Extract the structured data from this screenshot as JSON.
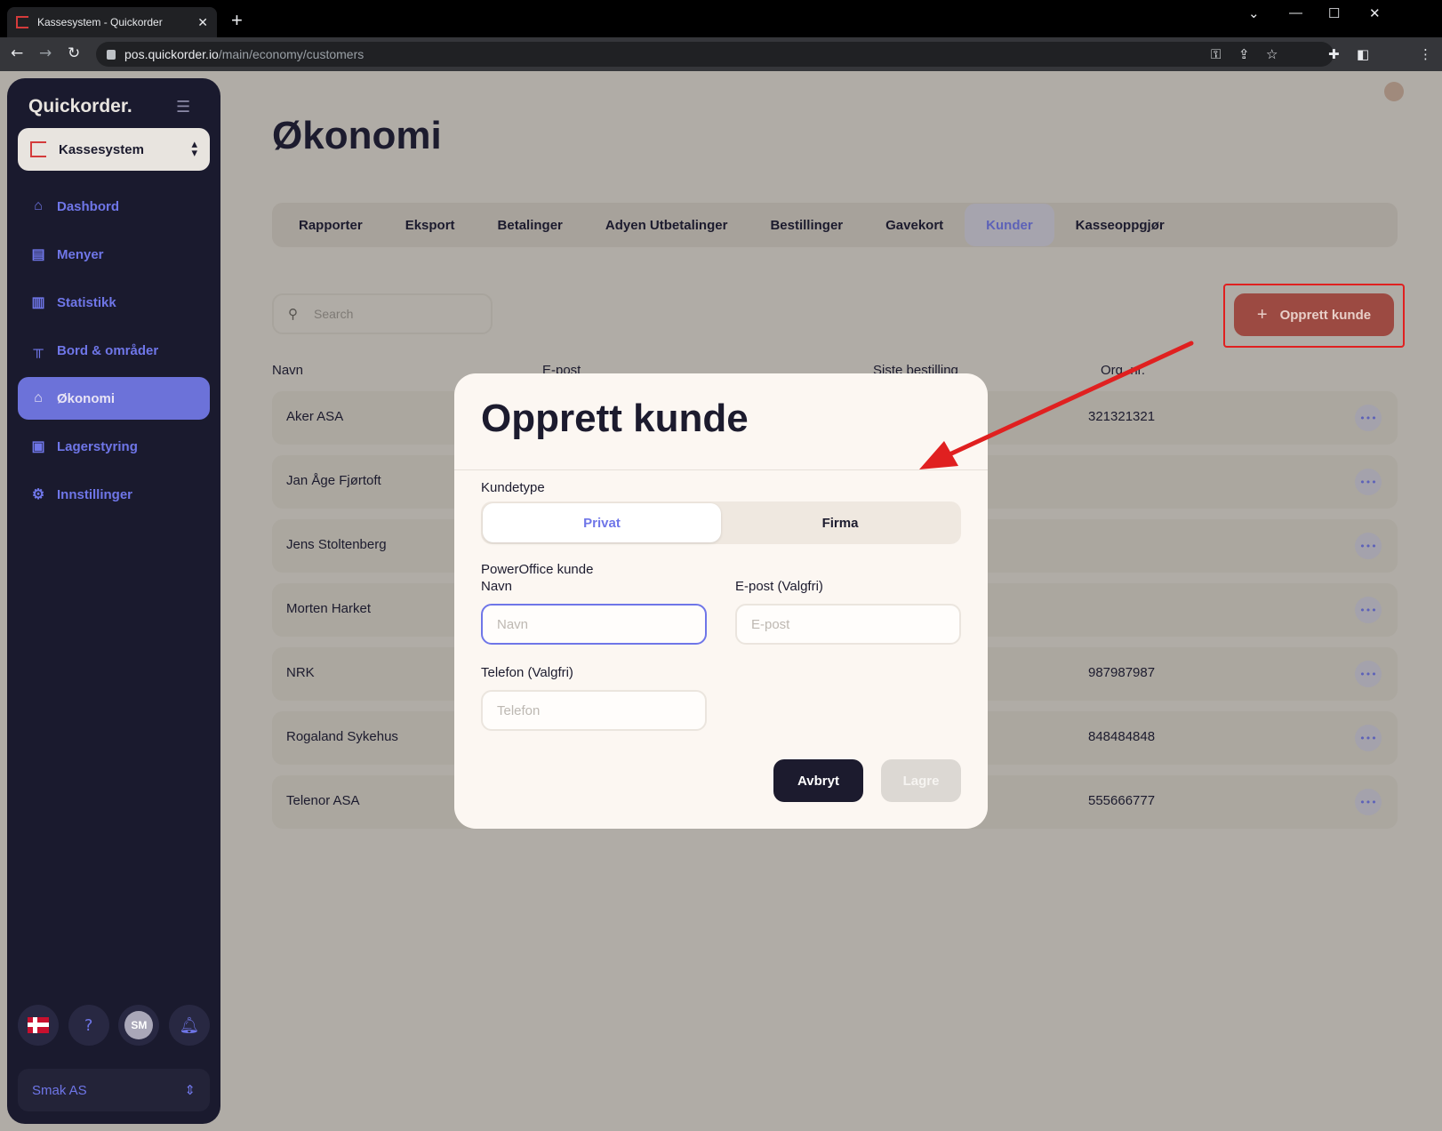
{
  "browser": {
    "tab_title": "Kassesystem - Quickorder",
    "url_host": "pos.quickorder.io",
    "url_path": "/main/economy/customers"
  },
  "sidebar": {
    "brand": "Quickorder.",
    "system_selector": "Kassesystem",
    "items": [
      {
        "label": "Dashbord",
        "icon": "home-icon"
      },
      {
        "label": "Menyer",
        "icon": "book-icon"
      },
      {
        "label": "Statistikk",
        "icon": "chart-icon"
      },
      {
        "label": "Bord & områder",
        "icon": "table-icon"
      },
      {
        "label": "Økonomi",
        "icon": "bank-icon",
        "active": true
      },
      {
        "label": "Lagerstyring",
        "icon": "archive-icon"
      },
      {
        "label": "Innstillinger",
        "icon": "gear-icon"
      }
    ],
    "user_initials": "SM",
    "org_selector": "Smak AS"
  },
  "page": {
    "title": "Økonomi",
    "tabs": [
      "Rapporter",
      "Eksport",
      "Betalinger",
      "Adyen Utbetalinger",
      "Bestillinger",
      "Gavekort",
      "Kunder",
      "Kasseoppgjør"
    ],
    "active_tab": "Kunder",
    "search_placeholder": "Search",
    "create_button": "Opprett kunde",
    "columns": [
      "Navn",
      "E-post",
      "Siste bestilling",
      "Org. nr."
    ],
    "customers": [
      {
        "name": "Aker ASA",
        "org": "321321321"
      },
      {
        "name": "Jan Åge Fjørtoft",
        "org": ""
      },
      {
        "name": "Jens Stoltenberg",
        "org": ""
      },
      {
        "name": "Morten Harket",
        "org": ""
      },
      {
        "name": "NRK",
        "org": "987987987"
      },
      {
        "name": "Rogaland Sykehus",
        "org": "848484848"
      },
      {
        "name": "Telenor ASA",
        "org": "555666777"
      }
    ]
  },
  "modal": {
    "title": "Opprett kunde",
    "customer_type_label": "Kundetype",
    "segment_private": "Privat",
    "segment_company": "Firma",
    "poweroffice_label": "PowerOffice kunde",
    "name_label": "Navn",
    "name_placeholder": "Navn",
    "email_label": "E-post (Valgfri)",
    "email_placeholder": "E-post",
    "phone_label": "Telefon (Valgfri)",
    "phone_placeholder": "Telefon",
    "cancel_button": "Avbryt",
    "save_button": "Lagre"
  },
  "colors": {
    "accent": "#6f76e8",
    "sidebar_bg": "#1a1a2e",
    "create_button": "#9c4a42",
    "annotation_red": "#e02020"
  }
}
